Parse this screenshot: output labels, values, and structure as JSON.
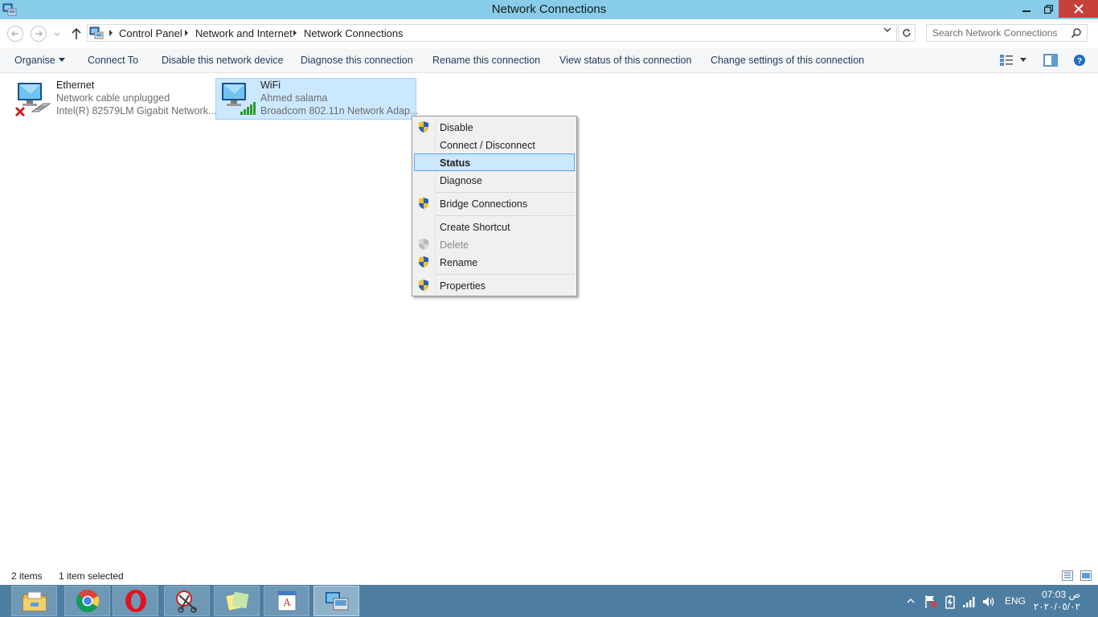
{
  "window": {
    "title": "Network Connections"
  },
  "address": {
    "crumbs": [
      "Control Panel",
      "Network and Internet",
      "Network Connections"
    ]
  },
  "search": {
    "placeholder": "Search Network Connections"
  },
  "toolbar": {
    "organise": "Organise",
    "connect_to": "Connect To",
    "disable_device": "Disable this network device",
    "diagnose": "Diagnose this connection",
    "rename": "Rename this connection",
    "view_status": "View status of this connection",
    "change_settings": "Change settings of this connection"
  },
  "connections": [
    {
      "name": "Ethernet",
      "status": "Network cable unplugged",
      "adapter": "Intel(R) 82579LM Gigabit Network...",
      "icon": "ethernet-disconnected-icon"
    },
    {
      "name": "WiFi",
      "status": "Ahmed salama",
      "adapter": "Broadcom 802.11n Network Adap...",
      "icon": "wifi-connection-icon",
      "selected": true
    }
  ],
  "context_menu": {
    "items": [
      {
        "label": "Disable",
        "shield": true
      },
      {
        "label": "Connect / Disconnect",
        "shield": false
      },
      {
        "label": "Status",
        "shield": false,
        "highlighted": true
      },
      {
        "label": "Diagnose",
        "shield": false
      },
      {
        "label": "Bridge Connections",
        "shield": true
      },
      {
        "label": "Create Shortcut",
        "shield": false
      },
      {
        "label": "Delete",
        "shield": true,
        "disabled": true
      },
      {
        "label": "Rename",
        "shield": true
      },
      {
        "label": "Properties",
        "shield": true
      }
    ]
  },
  "statusbar": {
    "count": "2 items",
    "selection": "1 item selected"
  },
  "taskbar": {
    "apps": [
      "file-explorer-icon",
      "chrome-icon",
      "opera-icon",
      "snipping-tool-icon",
      "sticky-notes-icon",
      "wordpad-icon",
      "network-connections-icon"
    ],
    "language": "ENG",
    "time": "07:03 ص",
    "date": "٢٠٢٠/٠٥/٠٢"
  },
  "colors": {
    "titlebar": "#87cdea",
    "close_button": "#c7413a",
    "selection": "#cce8ff",
    "taskbar": "#4d7da0"
  }
}
